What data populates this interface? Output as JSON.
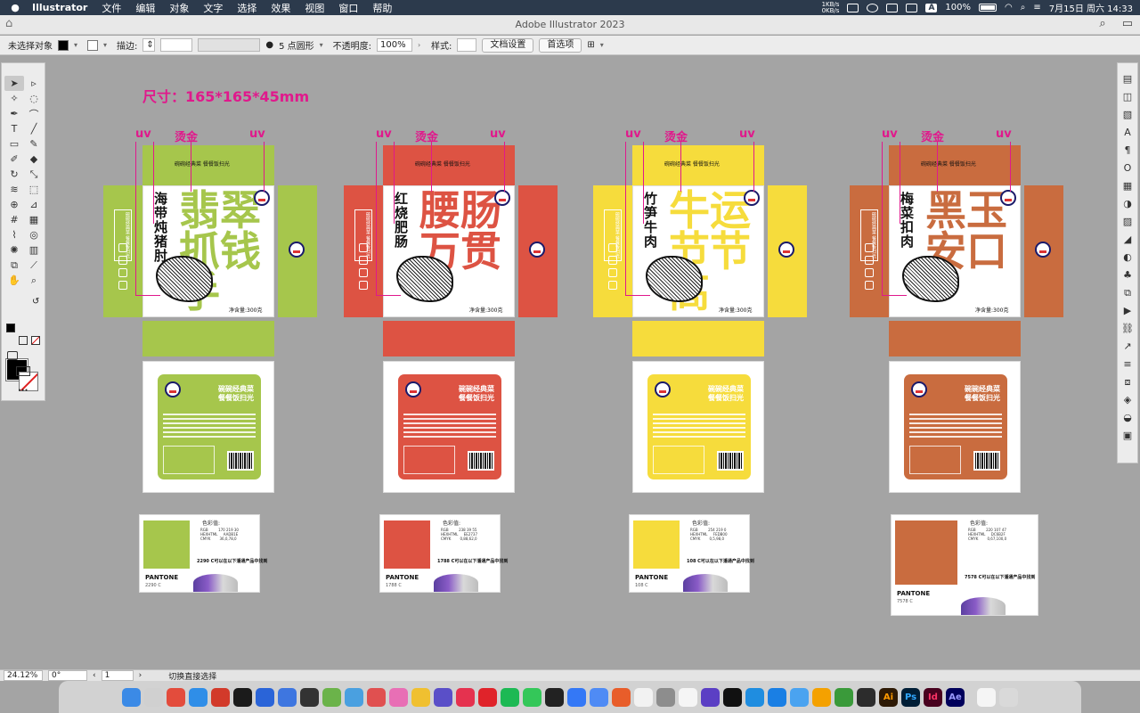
{
  "menubar": {
    "app": "Illustrator",
    "menus": [
      "文件",
      "编辑",
      "对象",
      "文字",
      "选择",
      "效果",
      "视图",
      "窗口",
      "帮助"
    ],
    "net_up": "1KB/s",
    "net_down": "0KB/s",
    "input_badge": "A",
    "battery": "100%",
    "datetime": "7月15日 周六  14:33"
  },
  "titlebar": {
    "title": "Adobe Illustrator 2023"
  },
  "controlbar": {
    "selection": "未选择对象",
    "stroke_label": "描边:",
    "stroke_value": "",
    "brush": "5 点圆形",
    "opacity_label": "不透明度:",
    "opacity_value": "100%",
    "style_label": "样式:",
    "doc_settings": "文档设置",
    "preferences": "首选项"
  },
  "artboard": {
    "dimension": "尺寸：165*165*45mm",
    "ann_uv": "uv",
    "ann_foil": "烫金",
    "slogan": "碗碗经典菜 餐餐饭扫光",
    "net_weight": "净含量:300克",
    "back_title1": "碗碗经典菜",
    "back_title2": "餐餐饭扫光",
    "pantone_head": "色彩值:",
    "pantone_brand": "PANTONE",
    "products": [
      {
        "name": "海带炖猪肘",
        "big": "翡翠抓钱手",
        "color": "#a6c64c",
        "pantone_code": "2290 C",
        "pantone_desc": "2290 C可以在以下潘通产品中找到",
        "values": "RGB         170 219 30\nHEXHTML     AADB1E\nCMYK        36,0,78,0"
      },
      {
        "name": "红烧肥肠",
        "big": "腰肠万贯",
        "color": "#dd5343",
        "pantone_code": "1788 C",
        "pantone_desc": "1788 C可以在以下潘通产品中找到",
        "values": "RGB         238 39 55\nHEXHTML     EE2737\nCMYK        0,88,62,0"
      },
      {
        "name": "竹笋牛肉",
        "big": "牛运节节高",
        "color": "#f6dc3c",
        "pantone_code": "108 C",
        "pantone_desc": "108 C可以在以下潘通产品中找到",
        "values": "RGB         254 219 0\nHEXHTML     FEDB00\nCMYK        0,5,98,0"
      },
      {
        "name": "梅菜扣肉",
        "big": "黑玉安口",
        "color": "#c96c3f",
        "pantone_code": "7578 C",
        "pantone_desc": "7578 C可以在以下潘通产品中找到",
        "values": "RGB         220 107 47\nHEXHTML     DC6B2F\nCMYK        0,67,100,0"
      }
    ]
  },
  "bottombar": {
    "zoom": "24.12%",
    "rotation": "0°",
    "artboard_index": "1",
    "status": "切换直接选择"
  }
}
